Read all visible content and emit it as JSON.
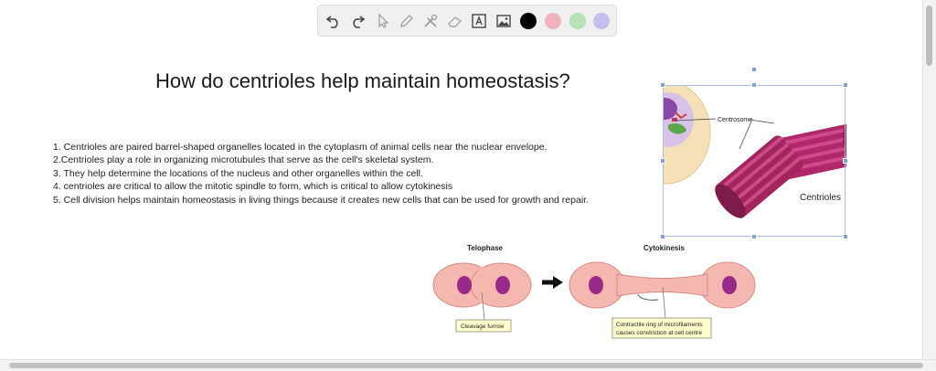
{
  "toolbar": {
    "tools": [
      "undo-icon",
      "redo-icon",
      "pointer-icon",
      "pen-icon",
      "tools-icon",
      "eraser-icon",
      "text-icon",
      "image-icon"
    ],
    "colors": [
      "#000000",
      "#f0b3bd",
      "#b6e0b6",
      "#c3c0f0"
    ]
  },
  "content": {
    "title": "How do centrioles help maintain homeostasis?",
    "list": [
      "1. Centrioles are paired barrel-shaped organelles located in the cytoplasm of animal cells near the nuclear envelope.",
      "2.Centrioles play a role in organizing microtubules that serve as the cell's skeletal system.",
      "3. They help determine the locations of the nucleus and other organelles within the cell.",
      "4. centrioles are critical to allow the mitotic spindle to form, which is critical to allow cytokinesis",
      "5. Cell division helps maintain homeostasis in living things because it creates new cells that can be used for growth and repair."
    ]
  },
  "figure1": {
    "centrosome_label": "Centrosome",
    "centrioles_label": "Centrioles"
  },
  "figure2": {
    "telophase_label": "Telophase",
    "cytokinesis_label": "Cytokinesis",
    "cleavage_label": "Cleavage furrow",
    "ring_label_line1": "Contractile ring of microfilaments",
    "ring_label_line2": "causes constriction at cell centre"
  }
}
